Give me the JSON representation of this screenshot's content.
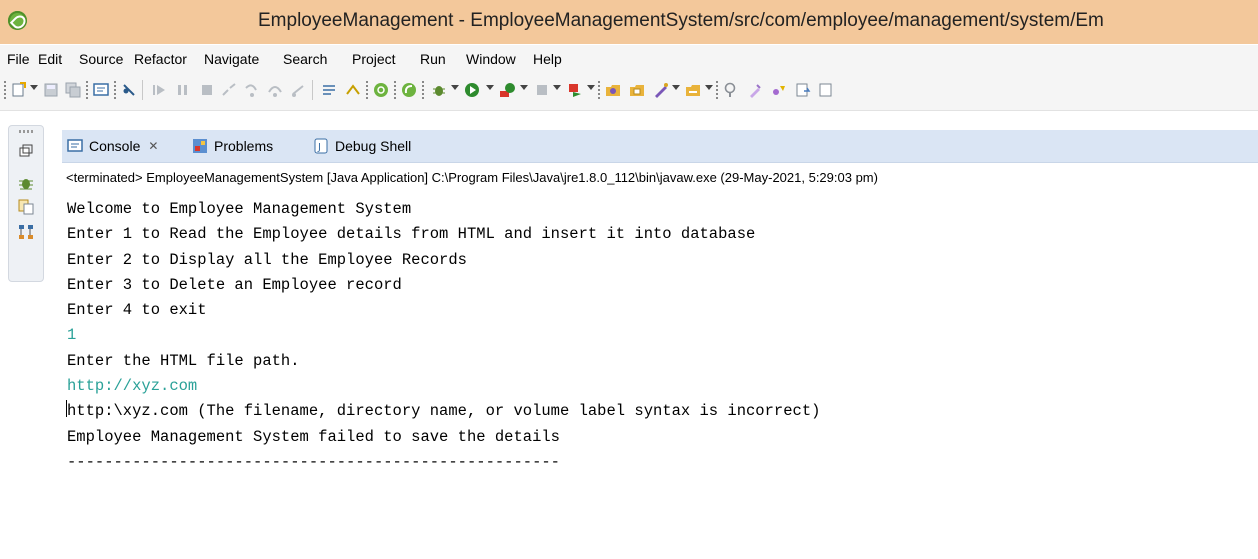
{
  "window": {
    "title": "EmployeeManagement - EmployeeManagementSystem/src/com/employee/management/system/Em"
  },
  "menubar": {
    "items": [
      {
        "label": "File"
      },
      {
        "label": "Edit"
      },
      {
        "label": "Source"
      },
      {
        "label": "Refactor"
      },
      {
        "label": "Navigate"
      },
      {
        "label": "Search"
      },
      {
        "label": "Project"
      },
      {
        "label": "Run"
      },
      {
        "label": "Window"
      },
      {
        "label": "Help"
      }
    ]
  },
  "toolbar": {
    "icons": [
      "new-icon",
      "save-icon",
      "save-all-icon",
      "console-icon",
      "skip-breakpoints-icon",
      "resume-icon",
      "suspend-icon",
      "terminate-icon",
      "disconnect-icon",
      "step-into-icon",
      "step-over-icon",
      "step-return-icon",
      "drop-to-frame-icon",
      "use-step-filters-icon",
      "boot-dashboard-icon",
      "spring-icon",
      "debug-icon",
      "run-icon",
      "coverage-icon",
      "external-tools-icon",
      "new-java-project-icon",
      "open-type-icon",
      "open-task-icon",
      "search-icon",
      "pin-icon",
      "annotation-icon",
      "last-edit-icon"
    ]
  },
  "trim": {
    "icons": [
      "restore-icon",
      "bug-icon",
      "copy-icon",
      "hierarchy-icon"
    ]
  },
  "tabs": [
    {
      "label": "Console",
      "active": true
    },
    {
      "label": "Problems",
      "active": false
    },
    {
      "label": "Debug Shell",
      "active": false
    }
  ],
  "console": {
    "description": "<terminated> EmployeeManagementSystem [Java Application] C:\\Program Files\\Java\\jre1.8.0_112\\bin\\javaw.exe (29-May-2021, 5:29:03 pm)",
    "lines": [
      {
        "text": "Welcome to Employee Management System",
        "type": "output"
      },
      {
        "text": "Enter 1 to Read the Employee details from HTML and insert it into database",
        "type": "output"
      },
      {
        "text": "Enter 2 to Display all the Employee Records",
        "type": "output"
      },
      {
        "text": "Enter 3 to Delete an Employee record",
        "type": "output"
      },
      {
        "text": "Enter 4 to exit",
        "type": "output"
      },
      {
        "text": "1",
        "type": "input"
      },
      {
        "text": "Enter the HTML file path.",
        "type": "output"
      },
      {
        "text": "http://xyz.com",
        "type": "input"
      },
      {
        "text": "http:\\xyz.com (The filename, directory name, or volume label syntax is incorrect)",
        "type": "output"
      },
      {
        "text": "Employee Management System failed to save the details",
        "type": "output"
      },
      {
        "text": "-----------------------------------------------------",
        "type": "output"
      }
    ]
  },
  "colors": {
    "title_bar": "#f3c89b",
    "tab_bar": "#dae5f4",
    "stdin_text": "#2aa198"
  }
}
